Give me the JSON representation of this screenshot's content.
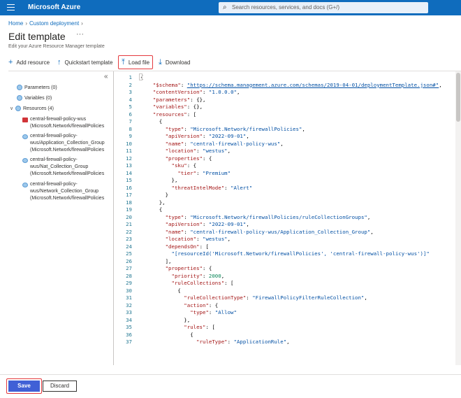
{
  "header": {
    "brand": "Microsoft Azure",
    "search_placeholder": "Search resources, services, and docs (G+/)"
  },
  "breadcrumb": [
    "Home",
    "Custom deployment"
  ],
  "page": {
    "title": "Edit template",
    "subtitle": "Edit your Azure Resource Manager template",
    "more": "···"
  },
  "toolbar": {
    "add_resource": "Add resource",
    "quickstart": "Quickstart template",
    "load_file": "Load file",
    "download": "Download"
  },
  "tree": {
    "parameters": "Parameters (0)",
    "variables": "Variables (0)",
    "resources": "Resources (4)",
    "items": [
      {
        "line1": "central-firewall-policy-wus",
        "line2": "(Microsoft.Network/firewallPolicies"
      },
      {
        "line1": "central-firewall-policy-",
        "line1b": "wus/Application_Collection_Group",
        "line2": "(Microsoft.Network/firewallPolicies"
      },
      {
        "line1": "central-firewall-policy-",
        "line1b": "wus/Nat_Collection_Group",
        "line2": "(Microsoft.Network/firewallPolicies"
      },
      {
        "line1": "central-firewall-policy-",
        "line1b": "wus/Network_Collection_Group",
        "line2": "(Microsoft.Network/firewallPolicies"
      }
    ]
  },
  "code": [
    "{",
    "    \"$schema\": \"https://schema.management.azure.com/schemas/2019-04-01/deploymentTemplate.json#\",",
    "    \"contentVersion\": \"1.0.0.0\",",
    "    \"parameters\": {},",
    "    \"variables\": {},",
    "    \"resources\": [",
    "      {",
    "        \"type\": \"Microsoft.Network/firewallPolicies\",",
    "        \"apiVersion\": \"2022-09-01\",",
    "        \"name\": \"central-firewall-policy-wus\",",
    "        \"location\": \"westus\",",
    "        \"properties\": {",
    "          \"sku\": {",
    "            \"tier\": \"Premium\"",
    "          },",
    "          \"threatIntelMode\": \"Alert\"",
    "        }",
    "      },",
    "      {",
    "        \"type\": \"Microsoft.Network/firewallPolicies/ruleCollectionGroups\",",
    "        \"apiVersion\": \"2022-09-01\",",
    "        \"name\": \"central-firewall-policy-wus/Application_Collection_Group\",",
    "        \"location\": \"westus\",",
    "        \"dependsOn\": [",
    "          \"[resourceId('Microsoft.Network/firewallPolicies', 'central-firewall-policy-wus')]\"",
    "        ],",
    "        \"properties\": {",
    "          \"priority\": 2000,",
    "          \"ruleCollections\": [",
    "            {",
    "              \"ruleCollectionType\": \"FirewallPolicyFilterRuleCollection\",",
    "              \"action\": {",
    "                \"type\": \"Allow\"",
    "              },",
    "              \"rules\": [",
    "                {",
    "                  \"ruleType\": \"ApplicationRule\","
  ],
  "footer": {
    "save": "Save",
    "discard": "Discard"
  },
  "icons": {
    "search": "search-icon",
    "add": "plus-icon",
    "quickstart": "arrow-up-icon",
    "load": "upload-icon",
    "download": "download-icon"
  },
  "colors": {
    "topbar": "#0f6cbd",
    "primary_button": "#4060d6",
    "highlight": "#e43a3e"
  }
}
